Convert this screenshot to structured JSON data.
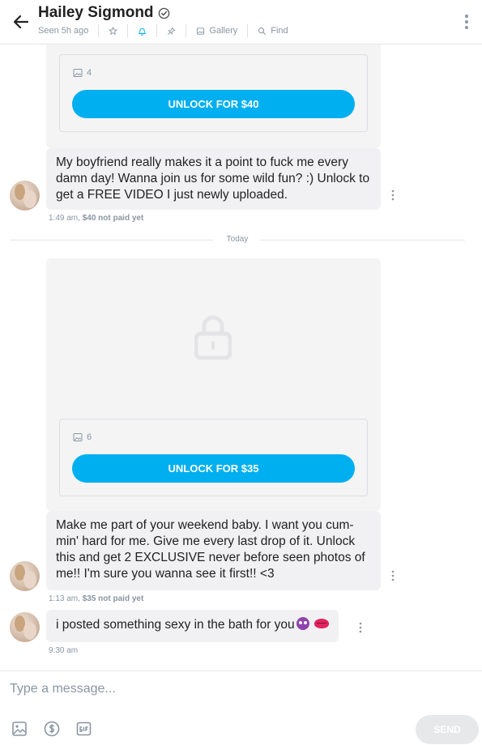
{
  "header": {
    "title": "Hailey Sigmond",
    "seen": "Seen 5h ago",
    "gallery_label": "Gallery",
    "find_label": "Find",
    "icons": [
      "back-arrow-icon",
      "verified-icon",
      "star-icon",
      "bell-icon",
      "pin-icon",
      "gallery-icon",
      "search-icon",
      "more-vertical-icon"
    ]
  },
  "messages": [
    {
      "media_count": "4",
      "unlock_label": "UNLOCK FOR $40",
      "text": "My boyfriend really makes it a point to fuck me every damn day! Wanna join us for some wild fun? :) Unlock to get a FREE VIDEO I just newly uploaded.",
      "time": "1:49 am,",
      "status": "$40 not paid yet"
    },
    {
      "media_count": "6",
      "unlock_label": "UNLOCK FOR $35",
      "text": "Make me part of your weekend baby. I want you cum-min' hard for me. Give me every last drop of it. Unlock this and get 2 EXCLUSIVE never before seen photos of me!! I'm sure you wanna see it first!! <3",
      "time": "1:13 am,",
      "status": "$35 not paid yet"
    },
    {
      "text": "i posted something sexy in the bath for you",
      "time": "9:30 am"
    }
  ],
  "divider_label": "Today",
  "composer": {
    "placeholder": "Type a message...",
    "send_label": "SEND"
  },
  "colors": {
    "accent": "#00aff0",
    "muted": "#8a96a3",
    "bubble": "#f1f1f3"
  }
}
